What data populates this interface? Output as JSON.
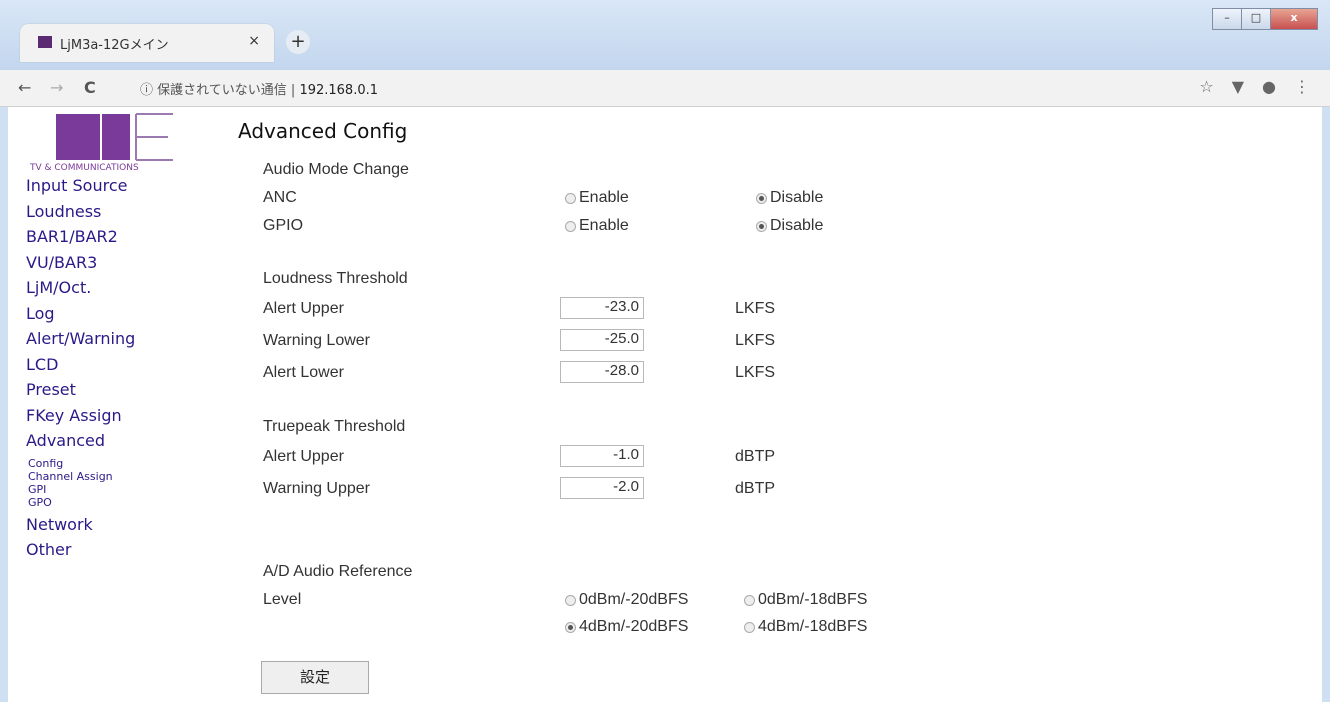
{
  "tab": {
    "title": "LjM3a-12Gメイン",
    "close": "×",
    "new_tab": "+"
  },
  "window": {
    "minimize": "–",
    "maximize": "□",
    "close": "x"
  },
  "address": {
    "back": "←",
    "forward": "→",
    "reload": "C",
    "info": "ⓘ",
    "insecure": "保護されていない通信",
    "host": "192.168.0.1",
    "star": "☆",
    "ext": "▼",
    "menu": "⋮"
  },
  "logo": {
    "tagline": "TV & COMMUNICATIONS"
  },
  "sidebar": {
    "items": [
      "Input Source",
      "Loudness",
      "BAR1/BAR2",
      "VU/BAR3",
      "LjM/Oct.",
      "Log",
      "Alert/Warning",
      "LCD",
      "Preset",
      "FKey Assign",
      "Advanced"
    ],
    "subs": [
      "Config",
      "Channel Assign",
      "GPI",
      "GPO"
    ],
    "after": [
      "Network",
      "Other"
    ]
  },
  "page": {
    "title": "Advanced Config"
  },
  "audio_mode": {
    "heading": "Audio Mode Change",
    "rows": [
      {
        "label": "ANC",
        "enable": "Enable",
        "disable": "Disable",
        "selected": "Disable"
      },
      {
        "label": "GPIO",
        "enable": "Enable",
        "disable": "Disable",
        "selected": "Disable"
      }
    ]
  },
  "loudness": {
    "heading": "Loudness Threshold",
    "rows": [
      {
        "label": "Alert Upper",
        "value": "-23.0",
        "unit": "LKFS"
      },
      {
        "label": "Warning Lower",
        "value": "-25.0",
        "unit": "LKFS"
      },
      {
        "label": "Alert Lower",
        "value": "-28.0",
        "unit": "LKFS"
      }
    ]
  },
  "truepeak": {
    "heading": "Truepeak Threshold",
    "rows": [
      {
        "label": "Alert Upper",
        "value": "-1.0",
        "unit": "dBTP"
      },
      {
        "label": "Warning Upper",
        "value": "-2.0",
        "unit": "dBTP"
      }
    ]
  },
  "ad_ref": {
    "heading": "A/D Audio Reference",
    "label": "Level",
    "options": [
      "0dBm/-20dBFS",
      "0dBm/-18dBFS",
      "4dBm/-20dBFS",
      "4dBm/-18dBFS"
    ],
    "selected": "4dBm/-20dBFS"
  },
  "submit": "設定",
  "colors": {
    "link": "#2a1a88",
    "logo_purple": "#7a3a9a"
  }
}
